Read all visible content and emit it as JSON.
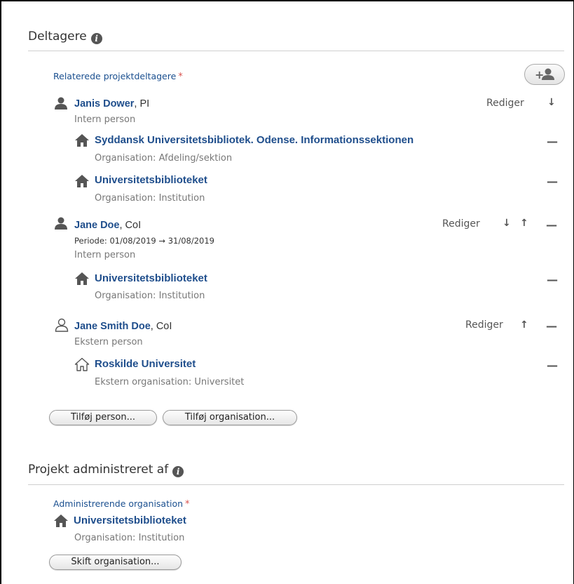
{
  "participants_section": {
    "title": "Deltagere",
    "field_label": "Relaterede projektdeltagere",
    "required_mark": "*",
    "people": [
      {
        "name": "Janis Dower",
        "role": ", PI",
        "type": "Intern person",
        "edit_label": "Rediger",
        "icon": "person-filled-icon",
        "orgs": [
          {
            "name": "Syddansk Universitetsbibliotek. Odense. Informationssektionen",
            "type": "Organisation: Afdeling/sektion"
          },
          {
            "name": "Universitetsbiblioteket",
            "type": "Organisation: Institution"
          }
        ]
      },
      {
        "name": "Jane Doe",
        "role": ", CoI",
        "period": "Periode: 01/08/2019 → 31/08/2019",
        "type": "Intern person",
        "edit_label": "Rediger",
        "icon": "person-filled-icon",
        "orgs": [
          {
            "name": "Universitetsbiblioteket",
            "type": "Organisation: Institution"
          }
        ]
      },
      {
        "name": "Jane Smith Doe",
        "role": ", CoI",
        "type": "Ekstern person",
        "edit_label": "Rediger",
        "icon": "person-outline-icon",
        "orgs": [
          {
            "name": "Roskilde Universitet",
            "type": "Ekstern organisation: Universitet"
          }
        ]
      }
    ],
    "add_person_label": "Tilføj person...",
    "add_org_label": "Tilføj organisation...",
    "add_participant_icon": "add-person-icon"
  },
  "managed_section": {
    "title": "Projekt administreret af",
    "field_label": "Administrerende organisation",
    "required_mark": "*",
    "org_name": "Universitetsbiblioteket",
    "org_type": "Organisation: Institution",
    "change_label": "Skift organisation..."
  },
  "colors": {
    "link": "#1f4e8c",
    "required": "#d9534f",
    "muted": "#777777"
  },
  "icons": {
    "arrow_down": "↓",
    "arrow_up": "↑",
    "remove": "—"
  }
}
